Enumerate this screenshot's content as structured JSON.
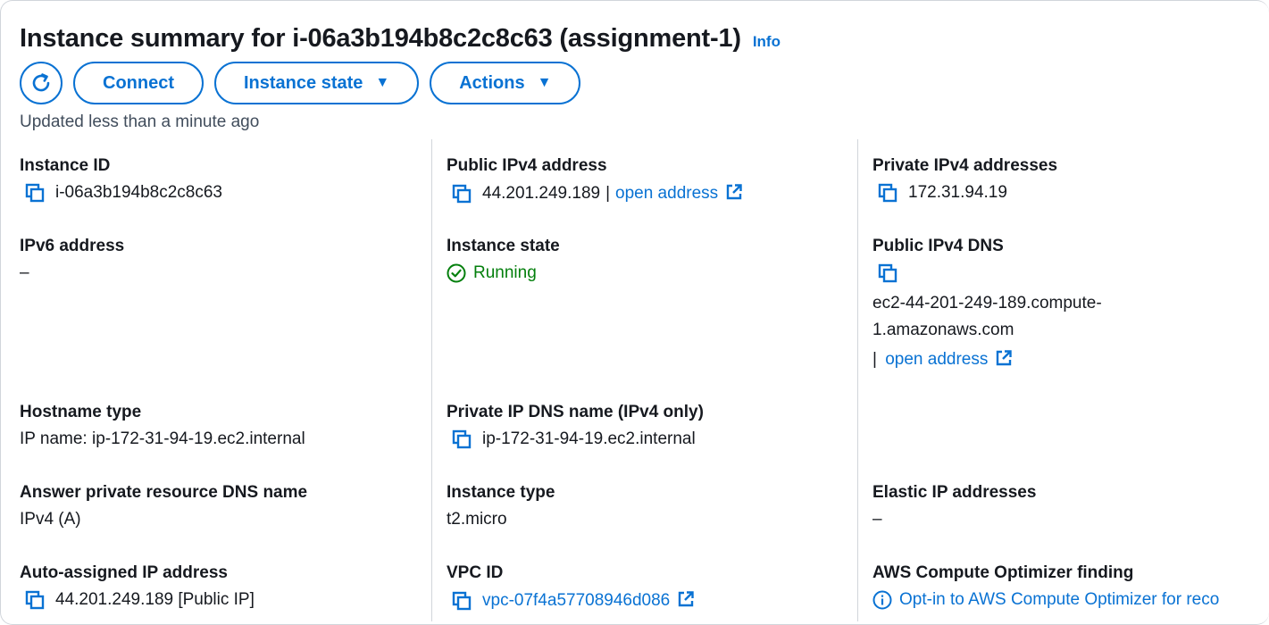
{
  "header": {
    "title": "Instance summary for i-06a3b194b8c2c8c63 (assignment-1)",
    "info_label": "Info"
  },
  "toolbar": {
    "refresh_icon": "refresh-icon",
    "connect_label": "Connect",
    "instance_state_label": "Instance state",
    "actions_label": "Actions"
  },
  "updated_text": "Updated less than a minute ago",
  "fields": {
    "instance_id": {
      "label": "Instance ID",
      "value": "i-06a3b194b8c2c8c63"
    },
    "public_ipv4": {
      "label": "Public IPv4 address",
      "value": "44.201.249.189",
      "separator": "|",
      "link": "open address"
    },
    "private_ipv4": {
      "label": "Private IPv4 addresses",
      "value": "172.31.94.19"
    },
    "ipv6": {
      "label": "IPv6 address",
      "value": "–"
    },
    "instance_state": {
      "label": "Instance state",
      "value": "Running"
    },
    "public_dns": {
      "label": "Public IPv4 DNS",
      "value_line1": "ec2-44-201-249-189.compute-",
      "value_line2": "1.amazonaws.com",
      "separator": "|",
      "link": "open address"
    },
    "hostname_type": {
      "label": "Hostname type",
      "value": "IP name: ip-172-31-94-19.ec2.internal"
    },
    "private_dns": {
      "label": "Private IP DNS name (IPv4 only)",
      "value": "ip-172-31-94-19.ec2.internal"
    },
    "answer_dns": {
      "label": "Answer private resource DNS name",
      "value": "IPv4 (A)"
    },
    "instance_type": {
      "label": "Instance type",
      "value": "t2.micro"
    },
    "elastic_ip": {
      "label": "Elastic IP addresses",
      "value": "–"
    },
    "auto_ip": {
      "label": "Auto-assigned IP address",
      "value": "44.201.249.189 [Public IP]"
    },
    "vpc_id": {
      "label": "VPC ID",
      "value": "vpc-07f4a57708946d086"
    },
    "optimizer": {
      "label": "AWS Compute Optimizer finding",
      "value": "Opt-in to AWS Compute Optimizer for reco"
    }
  },
  "colors": {
    "link": "#0972d3",
    "success": "#037f0c",
    "text": "#16191f",
    "muted": "#414d5c"
  }
}
